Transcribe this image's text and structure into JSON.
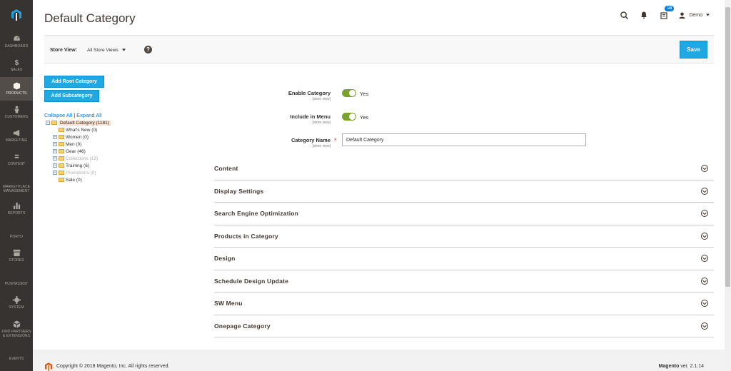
{
  "sidebar": {
    "items": [
      {
        "label": "DASHBOARD",
        "icon": "speedometer-icon",
        "name": "dashboard"
      },
      {
        "label": "SALES",
        "icon": "dollar-icon",
        "name": "sales"
      },
      {
        "label": "PRODUCTS",
        "icon": "cube-icon",
        "name": "products",
        "active": true
      },
      {
        "label": "CUSTOMERS",
        "icon": "person-icon",
        "name": "customers"
      },
      {
        "label": "MARKETING",
        "icon": "megaphone-icon",
        "name": "marketing"
      },
      {
        "label": "CONTENT",
        "icon": "content-icon",
        "name": "content"
      },
      {
        "label": "MARKETPLACE MANAGEMENT",
        "icon": "hexagon-icon",
        "name": "marketplace"
      },
      {
        "label": "REPORTS",
        "icon": "bar-chart-icon",
        "name": "reports"
      },
      {
        "label": "PORTO",
        "icon": "hexagon-icon",
        "name": "porto"
      },
      {
        "label": "STORES",
        "icon": "store-icon",
        "name": "stores"
      },
      {
        "label": "PUSHASSIST",
        "icon": "hexagon-icon",
        "name": "pushassist"
      },
      {
        "label": "SYSTEM",
        "icon": "gear-icon",
        "name": "system"
      },
      {
        "label": "FIND PARTNERS & EXTENSIONS",
        "icon": "blocks-icon",
        "name": "partners"
      },
      {
        "label": "EVENTS",
        "icon": "hexagon-icon",
        "name": "events"
      }
    ]
  },
  "header": {
    "title": "Default Category",
    "cart_badge": "1/0",
    "user_name": "Demo"
  },
  "store_bar": {
    "label": "Store View:",
    "selected": "All Store Views",
    "help": "?",
    "save_label": "Save"
  },
  "tree_panel": {
    "add_root_label": "Add Root Category",
    "add_sub_label": "Add Subcategory",
    "collapse_all": "Collapse All",
    "separator": "|",
    "expand_all": "Expand All",
    "nodes": [
      {
        "label": "Default Category (1181)",
        "root": true,
        "expander": "−"
      },
      {
        "label": "What's New (0)",
        "expander": ""
      },
      {
        "label": "Women (0)",
        "expander": "+"
      },
      {
        "label": "Men (0)",
        "expander": "+"
      },
      {
        "label": "Gear (46)",
        "expander": "+"
      },
      {
        "label": "Collections (13)",
        "expander": "+",
        "muted": true
      },
      {
        "label": "Training (6)",
        "expander": "+"
      },
      {
        "label": "Promotions (0)",
        "expander": "+",
        "muted": true
      },
      {
        "label": "Sale (0)",
        "expander": ""
      }
    ]
  },
  "form": {
    "enable_label": "Enable Category",
    "enable_scope": "[store view]",
    "enable_value": "Yes",
    "menu_label": "Include in Menu",
    "menu_scope": "[store view]",
    "menu_value": "Yes",
    "name_label": "Category Name",
    "name_scope": "[store view]",
    "name_required": "*",
    "name_value": "Default Category"
  },
  "sections": [
    "Content",
    "Display Settings",
    "Search Engine Optimization",
    "Products in Category",
    "Design",
    "Schedule Design Update",
    "SW Menu",
    "Onepage Category"
  ],
  "footer": {
    "copyright": "Copyright © 2018 Magento, Inc. All rights reserved.",
    "brand": "Magento",
    "version": " ver. 2.1.14"
  },
  "colors": {
    "sidebar_bg": "#373330",
    "sidebar_active": "#524d49",
    "primary_button": "#1fa8e1",
    "toggle_on": "#79a22e",
    "link": "#007bdb"
  }
}
